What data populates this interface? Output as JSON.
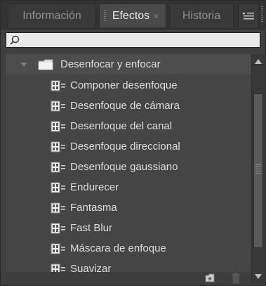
{
  "tabs": [
    {
      "label": "Información",
      "active": false
    },
    {
      "label": "Efectos",
      "active": true,
      "close": "×"
    },
    {
      "label": "Historia",
      "active": false
    }
  ],
  "search": {
    "value": "",
    "placeholder": ""
  },
  "tree": {
    "folder_label": "Desenfocar y enfocar",
    "effects": [
      "Componer desenfoque",
      "Desenfoque de cámara",
      "Desenfoque del canal",
      "Desenfoque direccional",
      "Desenfoque gaussiano",
      "Endurecer",
      "Fantasma",
      "Fast Blur",
      "Máscara de enfoque",
      "Suavizar"
    ]
  },
  "icons": {
    "search": "search-icon",
    "folder": "folder-icon",
    "effect": "effect-film-icon",
    "panel_menu": "panel-menu-icon",
    "new_bin": "new-bin-icon",
    "trash": "trash-icon"
  },
  "colors": {
    "panel_bg": "#404040",
    "active_tab": "#4a4a4a",
    "text": "#dcdcdc",
    "search_bg": "#e9e9e9"
  }
}
